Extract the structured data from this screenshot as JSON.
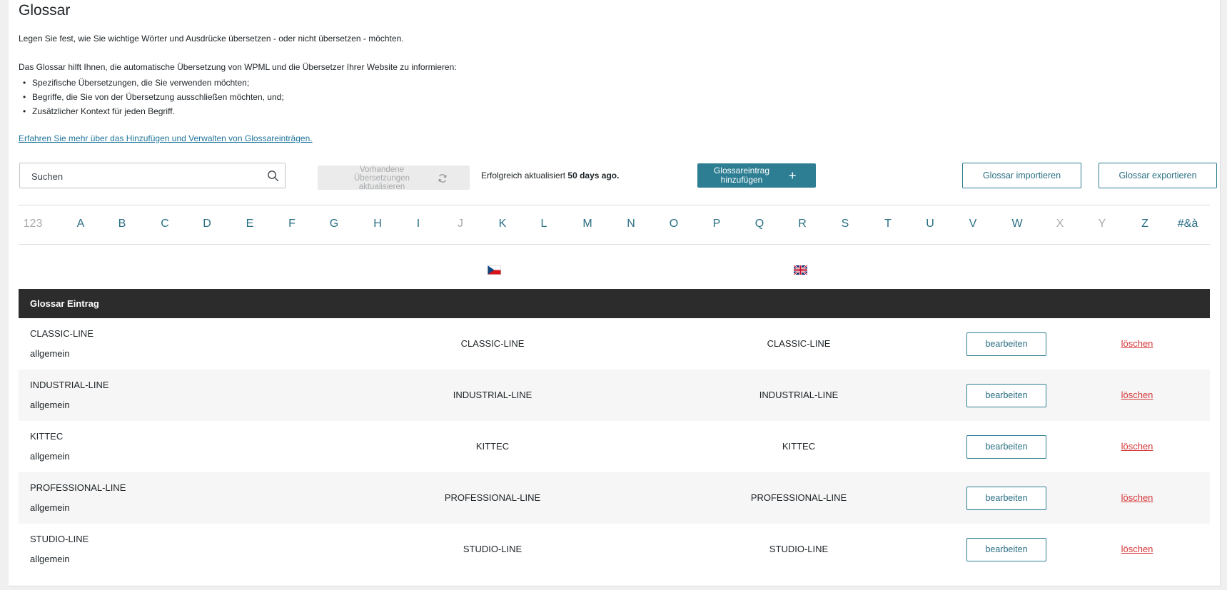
{
  "page": {
    "title": "Glossar",
    "intro": "Legen Sie fest, wie Sie wichtige Wörter und Ausdrücke übersetzen - oder nicht übersetzen - möchten.",
    "help_text": "Das Glossar hilft Ihnen, die automatische Übersetzung von WPML und die Übersetzer Ihrer Website zu informieren:",
    "bullets": [
      "Spezifische Übersetzungen, die Sie verwenden möchten;",
      "Begriffe, die Sie von der Übersetzung ausschließen möchten, und;",
      "Zusätzlicher Kontext für jeden Begriff."
    ],
    "bullet_char": "•",
    "learn_more_link": "Erfahren Sie mehr über das Hinzufügen und Verwalten von Glossareinträgen."
  },
  "toolbar": {
    "search_placeholder": "Suchen",
    "refresh_label": "Vorhandene Übersetzungen aktualisieren",
    "status_prefix": "Erfolgreich aktualisiert",
    "status_time": "50 days ago.",
    "add_label": "Glossareintrag hinzufügen",
    "add_icon": "+",
    "import_label": "Glossar importieren",
    "export_label": "Glossar exportieren"
  },
  "alphabet": [
    {
      "label": "123",
      "disabled": true
    },
    {
      "label": "A",
      "disabled": false
    },
    {
      "label": "B",
      "disabled": false
    },
    {
      "label": "C",
      "disabled": false
    },
    {
      "label": "D",
      "disabled": false
    },
    {
      "label": "E",
      "disabled": false
    },
    {
      "label": "F",
      "disabled": false
    },
    {
      "label": "G",
      "disabled": false
    },
    {
      "label": "H",
      "disabled": false
    },
    {
      "label": "I",
      "disabled": false
    },
    {
      "label": "J",
      "disabled": true
    },
    {
      "label": "K",
      "disabled": false
    },
    {
      "label": "L",
      "disabled": false
    },
    {
      "label": "M",
      "disabled": false
    },
    {
      "label": "N",
      "disabled": false
    },
    {
      "label": "O",
      "disabled": false
    },
    {
      "label": "P",
      "disabled": false
    },
    {
      "label": "Q",
      "disabled": false
    },
    {
      "label": "R",
      "disabled": false
    },
    {
      "label": "S",
      "disabled": false
    },
    {
      "label": "T",
      "disabled": false
    },
    {
      "label": "U",
      "disabled": false
    },
    {
      "label": "V",
      "disabled": false
    },
    {
      "label": "W",
      "disabled": false
    },
    {
      "label": "X",
      "disabled": true
    },
    {
      "label": "Y",
      "disabled": true
    },
    {
      "label": "Z",
      "disabled": false
    },
    {
      "label": "#&à",
      "disabled": false
    }
  ],
  "languages": {
    "source_flag": "czech-flag-icon",
    "target_flag": "uk-flag-icon"
  },
  "table": {
    "header": "Glossar Eintrag",
    "edit_label": "bearbeiten",
    "delete_label": "löschen",
    "rows": [
      {
        "term": "CLASSIC-LINE",
        "category": "allgemein",
        "source": "CLASSIC-LINE",
        "target": "CLASSIC-LINE"
      },
      {
        "term": "INDUSTRIAL-LINE",
        "category": "allgemein",
        "source": "INDUSTRIAL-LINE",
        "target": "INDUSTRIAL-LINE"
      },
      {
        "term": "KITTEC",
        "category": "allgemein",
        "source": "KITTEC",
        "target": "KITTEC"
      },
      {
        "term": "PROFESSIONAL-LINE",
        "category": "allgemein",
        "source": "PROFESSIONAL-LINE",
        "target": "PROFESSIONAL-LINE"
      },
      {
        "term": "STUDIO-LINE",
        "category": "allgemein",
        "source": "STUDIO-LINE",
        "target": "STUDIO-LINE"
      }
    ]
  },
  "colors": {
    "accent": "#2e7e93",
    "link": "#21759b",
    "delete": "#d63638",
    "header_bg": "#2c2c2c"
  }
}
